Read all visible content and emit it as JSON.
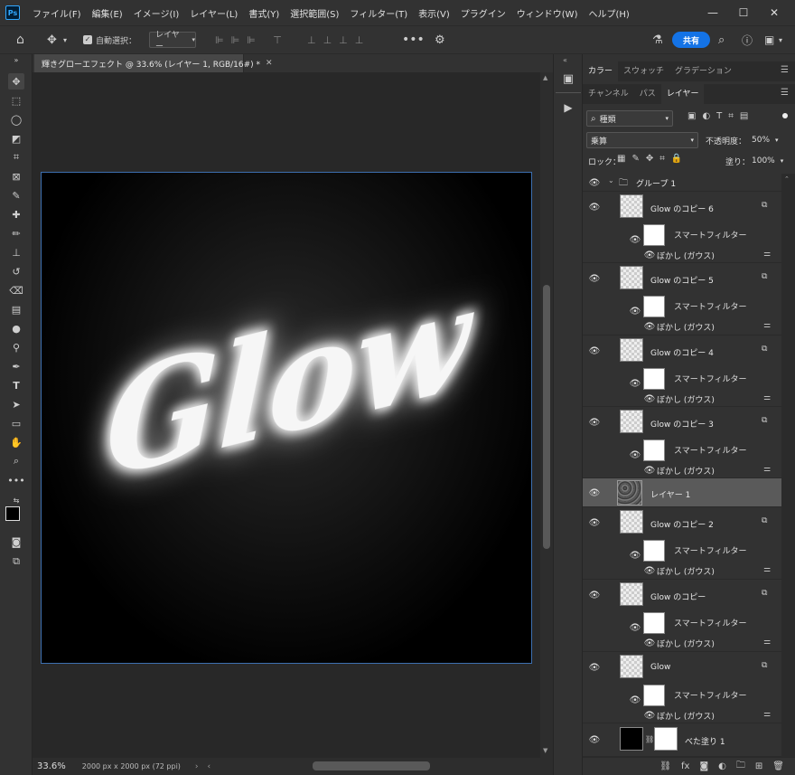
{
  "app": {
    "logo": "Ps"
  },
  "menu": [
    "ファイル(F)",
    "編集(E)",
    "イメージ(I)",
    "レイヤー(L)",
    "書式(Y)",
    "選択範囲(S)",
    "フィルター(T)",
    "表示(V)",
    "プラグイン",
    "ウィンドウ(W)",
    "ヘルプ(H)"
  ],
  "window_controls": {
    "minimize": "—",
    "maximize": "☐",
    "close": "✕"
  },
  "options": {
    "auto_select_label": "自動選択：",
    "auto_select_value": "レイヤー",
    "share_label": "共有"
  },
  "document": {
    "tab_title": "輝きグローエフェクト @ 33.6% (レイヤー 1, RGB/16#) *",
    "canvas_text": "Glow"
  },
  "status": {
    "zoom": "33.6%",
    "info": "2000 px x 2000 px (72 ppi)"
  },
  "panels": {
    "top_tabs": [
      "カラー",
      "スウォッチ",
      "グラデーション"
    ],
    "second_tabs": [
      "チャンネル",
      "パス",
      "レイヤー"
    ],
    "filter_kind": "種類",
    "blend_mode": "乗算",
    "opacity_label": "不透明度：",
    "opacity_value": "50%",
    "lock_label": "ロック：",
    "fill_label": "塗り：",
    "fill_value": "100%"
  },
  "layers": {
    "group_name": "グループ 1",
    "smart_filter_label": "スマートフィルター",
    "blur_label": "ぼかし (ガウス)",
    "items": [
      {
        "name": "Glow のコピー 6"
      },
      {
        "name": "Glow のコピー 5"
      },
      {
        "name": "Glow のコピー 4"
      },
      {
        "name": "Glow のコピー 3"
      },
      {
        "name": "レイヤー 1"
      },
      {
        "name": "Glow のコピー 2"
      },
      {
        "name": "Glow のコピー"
      },
      {
        "name": "Glow"
      },
      {
        "name": "べた塗り 1"
      }
    ]
  },
  "colors": {
    "accent": "#1473e6",
    "panel": "#323232",
    "selected_row": "#5a5a5a"
  }
}
